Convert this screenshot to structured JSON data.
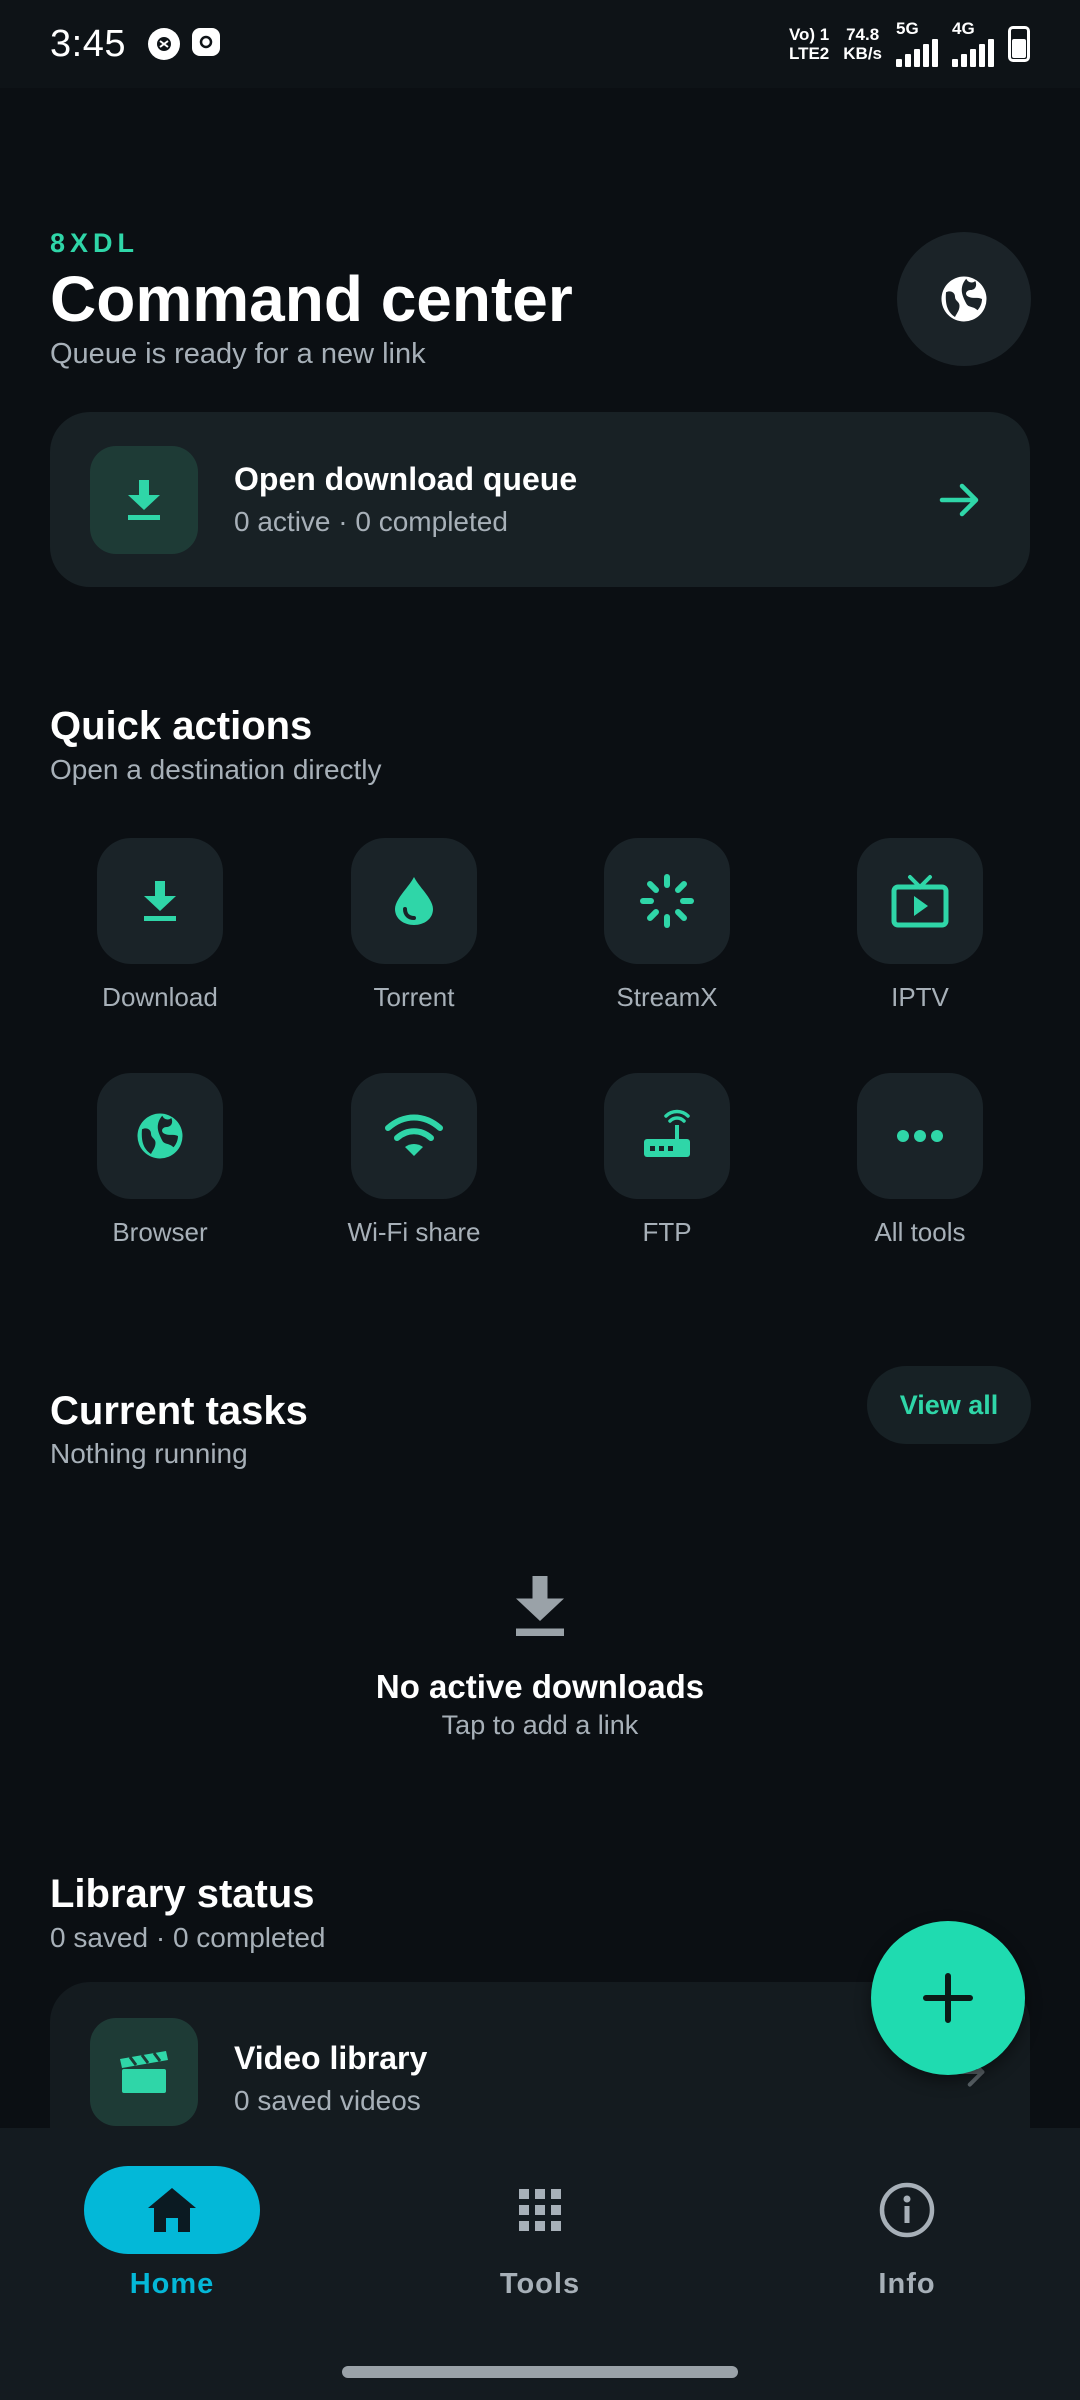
{
  "status_bar": {
    "time": "3:45",
    "volte": "Vo) 1",
    "lte": "LTE2",
    "speed_value": "74.8",
    "speed_unit": "KB/s",
    "net1": "5G",
    "net2": "4G"
  },
  "header": {
    "brand": "8XDL",
    "title": "Command center",
    "subtitle": "Queue is ready for a new link"
  },
  "queue_card": {
    "title": "Open download queue",
    "subtitle": "0 active · 0 completed"
  },
  "quick_actions": {
    "title": "Quick actions",
    "subtitle": "Open a destination directly",
    "items": [
      {
        "label": "Download",
        "icon": "download-icon"
      },
      {
        "label": "Torrent",
        "icon": "droplet-icon"
      },
      {
        "label": "StreamX",
        "icon": "loader-icon"
      },
      {
        "label": "IPTV",
        "icon": "tv-icon"
      },
      {
        "label": "Browser",
        "icon": "globe-icon"
      },
      {
        "label": "Wi-Fi share",
        "icon": "wifi-icon"
      },
      {
        "label": "FTP",
        "icon": "router-icon"
      },
      {
        "label": "All tools",
        "icon": "more-icon"
      }
    ]
  },
  "current_tasks": {
    "title": "Current tasks",
    "subtitle": "Nothing running",
    "view_all": "View all",
    "empty_title": "No active downloads",
    "empty_subtitle": "Tap to add a link"
  },
  "library_status": {
    "title": "Library status",
    "subtitle": "0 saved · 0 completed",
    "card_title": "Video library",
    "card_subtitle": "0 saved videos"
  },
  "bottom_nav": {
    "items": [
      {
        "label": "Home",
        "active": true
      },
      {
        "label": "Tools",
        "active": false
      },
      {
        "label": "Info",
        "active": false
      }
    ]
  },
  "colors": {
    "accent": "#2fd6a8",
    "nav_active": "#03b8d8",
    "background": "#0b0f13"
  }
}
